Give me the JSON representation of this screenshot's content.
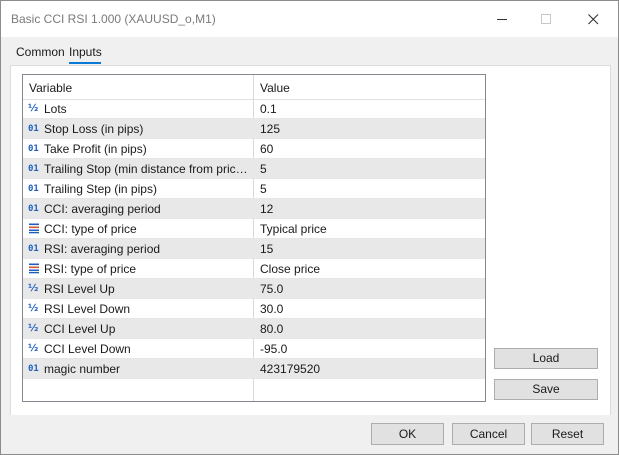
{
  "window": {
    "title": "Basic CCI RSI 1.000 (XAUUSD_o,M1)"
  },
  "tabs": [
    {
      "label": "Common"
    },
    {
      "label": "Inputs"
    }
  ],
  "grid": {
    "headers": {
      "variable": "Variable",
      "value": "Value"
    },
    "rows": [
      {
        "icon": "double-icon",
        "glyph": "½",
        "variable": "Lots",
        "value": "0.1"
      },
      {
        "icon": "integer-icon",
        "glyph": "01",
        "variable": "Stop Loss (in pips)",
        "value": "125"
      },
      {
        "icon": "integer-icon",
        "glyph": "01",
        "variable": "Take Profit (in pips)",
        "value": "60"
      },
      {
        "icon": "integer-icon",
        "glyph": "01",
        "variable": "Trailing Stop (min distance from price to ...",
        "value": "5"
      },
      {
        "icon": "integer-icon",
        "glyph": "01",
        "variable": "Trailing Step (in pips)",
        "value": "5"
      },
      {
        "icon": "integer-icon",
        "glyph": "01",
        "variable": "CCI: averaging period",
        "value": "12"
      },
      {
        "icon": "enum-icon",
        "glyph": "",
        "variable": "CCI: type of price",
        "value": "Typical price"
      },
      {
        "icon": "integer-icon",
        "glyph": "01",
        "variable": "RSI: averaging period",
        "value": "15"
      },
      {
        "icon": "enum-icon",
        "glyph": "",
        "variable": "RSI: type of price",
        "value": "Close price"
      },
      {
        "icon": "double-icon",
        "glyph": "½",
        "variable": "RSI Level Up",
        "value": "75.0"
      },
      {
        "icon": "double-icon",
        "glyph": "½",
        "variable": "RSI Level Down",
        "value": "30.0"
      },
      {
        "icon": "double-icon",
        "glyph": "½",
        "variable": "CCI Level Up",
        "value": "80.0"
      },
      {
        "icon": "double-icon",
        "glyph": "½",
        "variable": "CCI Level Down",
        "value": "-95.0"
      },
      {
        "icon": "integer-icon",
        "glyph": "01",
        "variable": "magic number",
        "value": "423179520"
      }
    ]
  },
  "side_buttons": {
    "load": "Load",
    "save": "Save"
  },
  "footer": {
    "ok": "OK",
    "cancel": "Cancel",
    "reset": "Reset"
  },
  "colors": {
    "accent": "#0a7ad6",
    "icon": "#1d5fbf"
  }
}
